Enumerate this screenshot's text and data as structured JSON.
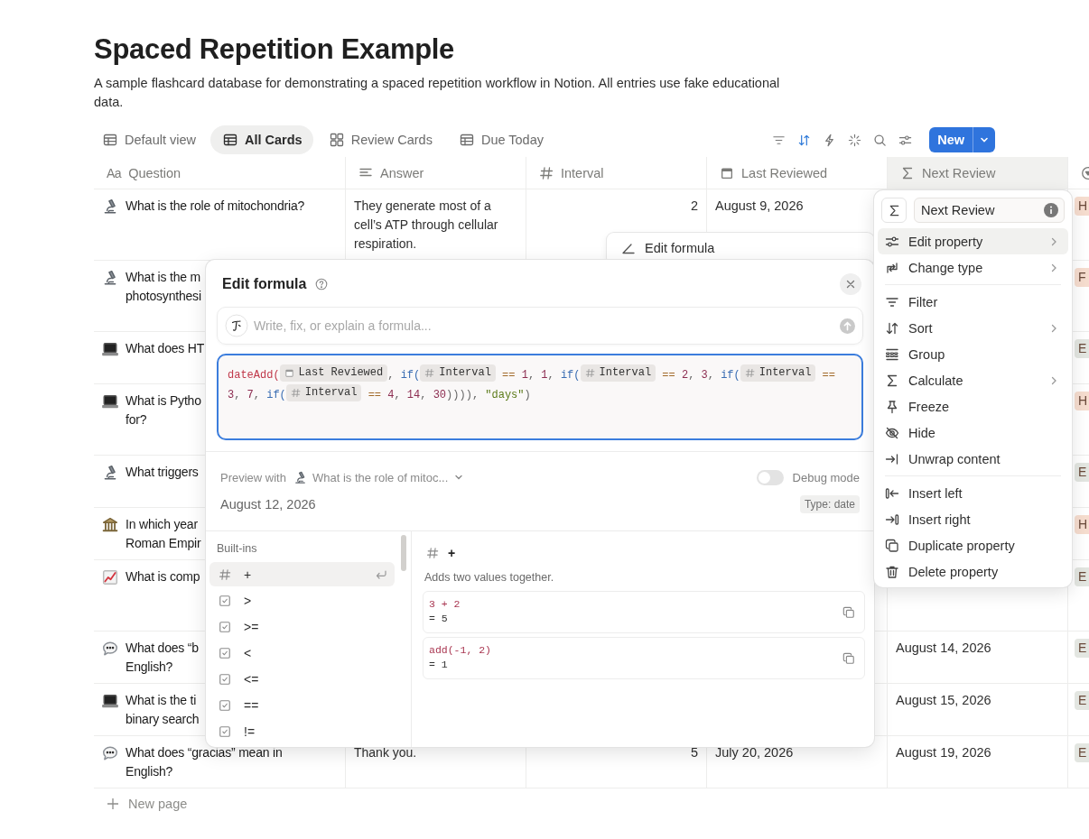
{
  "page": {
    "title": "Spaced Repetition Example",
    "description": "A sample flashcard database for demonstrating a spaced repetition workflow in Notion. All entries use fake educational data."
  },
  "tabs": [
    {
      "label": "Default view",
      "kind": "table",
      "selected": false
    },
    {
      "label": "All Cards",
      "kind": "table",
      "selected": true
    },
    {
      "label": "Review Cards",
      "kind": "gallery",
      "selected": false
    },
    {
      "label": "Due Today",
      "kind": "table",
      "selected": false
    }
  ],
  "toolbar": {
    "new_button": "New"
  },
  "columns": [
    {
      "label": "Question",
      "kind": "title",
      "glyph": "Aa",
      "selected": false
    },
    {
      "label": "Answer",
      "kind": "text",
      "selected": false
    },
    {
      "label": "Interval",
      "kind": "number",
      "selected": false
    },
    {
      "label": "Last Reviewed",
      "kind": "date",
      "selected": false
    },
    {
      "label": "Next Review",
      "kind": "formula",
      "selected": true
    },
    {
      "kind": "status",
      "selected": false
    }
  ],
  "rows": [
    {
      "kind": "microscope",
      "question": [
        "What is the role of mitochondria?"
      ],
      "answer": "They generate most of a cell’s ATP through cellular respiration.",
      "interval": "2",
      "last_reviewed": "August 9, 2026",
      "tag": {
        "text": "H",
        "color": "#f6ddcf"
      }
    },
    {
      "kind": "microscope",
      "question": [
        "What is the m",
        "photosynthesi"
      ],
      "tag": {
        "text": "F",
        "color": "#f6ddcf"
      }
    },
    {
      "kind": "laptop",
      "question": [
        "What does HT"
      ],
      "tag": {
        "text": "E",
        "color": "#e3e6e1"
      }
    },
    {
      "kind": "laptop",
      "question": [
        "What is Pytho",
        "for?"
      ],
      "tag": {
        "text": "H",
        "color": "#f6ddcf"
      }
    },
    {
      "kind": "microscope",
      "question": [
        "What triggers"
      ],
      "tag": {
        "text": "E",
        "color": "#e3e6e1"
      }
    },
    {
      "kind": "building",
      "question": [
        "In which year",
        "Roman Empir"
      ],
      "tag": {
        "text": "H",
        "color": "#f6ddcf"
      }
    },
    {
      "kind": "chart",
      "question": [
        "What is comp"
      ],
      "tag": {
        "text": "E",
        "color": "#e3e6e1"
      }
    },
    {
      "kind": "speech",
      "question": [
        "What does “b",
        "English?"
      ],
      "next_review": "August 14, 2026",
      "tag": {
        "text": "E",
        "color": "#e3e6e1"
      }
    },
    {
      "kind": "laptop",
      "question": [
        "What is the ti",
        "binary search"
      ],
      "next_review": "August 15, 2026",
      "tag": {
        "text": "E",
        "color": "#e3e6e1"
      }
    },
    {
      "kind": "speech",
      "question": [
        "What does “gracias” mean in",
        "English?"
      ],
      "answer": "Thank you.",
      "interval": "5",
      "last_reviewed": "July 20, 2026",
      "next_review": "August 19, 2026",
      "tag": {
        "text": "E",
        "color": "#e3e6e1"
      }
    }
  ],
  "new_page": "New page",
  "formula_bar": {
    "label": "Edit formula"
  },
  "formula_editor": {
    "title": "Edit formula",
    "ai_placeholder": "Write, fix, or explain a formula...",
    "tokens": [
      {
        "kind": "func",
        "text": "dateAdd("
      },
      {
        "kind": "date_prop",
        "text": "Last Reviewed"
      },
      {
        "kind": "punct",
        "text": ", "
      },
      {
        "kind": "keyword",
        "text": "if("
      },
      {
        "kind": "number_prop",
        "text": "Interval"
      },
      {
        "kind": "op",
        "text": " == "
      },
      {
        "kind": "num",
        "text": "1"
      },
      {
        "kind": "punct",
        "text": ", "
      },
      {
        "kind": "num",
        "text": "1"
      },
      {
        "kind": "punct",
        "text": ", "
      },
      {
        "kind": "keyword",
        "text": "if("
      },
      {
        "kind": "number_prop",
        "text": "Interval"
      },
      {
        "kind": "op",
        "text": " == "
      },
      {
        "kind": "num",
        "text": "2"
      },
      {
        "kind": "punct",
        "text": ", "
      },
      {
        "kind": "num",
        "text": "3"
      },
      {
        "kind": "punct",
        "text": ", "
      },
      {
        "kind": "keyword",
        "text": "if("
      },
      {
        "kind": "number_prop",
        "text": "Interval"
      },
      {
        "kind": "op",
        "text": " == "
      },
      {
        "kind": "num",
        "text": "3"
      },
      {
        "kind": "punct",
        "text": ", "
      },
      {
        "kind": "num",
        "text": "7"
      },
      {
        "kind": "punct",
        "text": ", "
      },
      {
        "kind": "keyword",
        "text": "if("
      },
      {
        "kind": "number_prop",
        "text": "Interval"
      },
      {
        "kind": "op",
        "text": " == "
      },
      {
        "kind": "num",
        "text": "4"
      },
      {
        "kind": "punct",
        "text": ", "
      },
      {
        "kind": "num",
        "text": "14"
      },
      {
        "kind": "punct",
        "text": ", "
      },
      {
        "kind": "num",
        "text": "30"
      },
      {
        "kind": "punct",
        "text": ")))), "
      },
      {
        "kind": "str",
        "text": "\"days\""
      },
      {
        "kind": "punct",
        "text": ")"
      }
    ],
    "preview": {
      "label": "Preview with",
      "page": "What is the role of mitoc...",
      "debug_label": "Debug mode",
      "debug_on": false,
      "result": "August 12, 2026",
      "type": "Type: date"
    },
    "builtins": {
      "heading": "Built-ins",
      "items": [
        {
          "kind": "number",
          "label": "+",
          "selected": true
        },
        {
          "kind": "checkbox",
          "label": ">",
          "selected": false
        },
        {
          "kind": "checkbox",
          "label": ">=",
          "selected": false
        },
        {
          "kind": "checkbox",
          "label": "<",
          "selected": false
        },
        {
          "kind": "checkbox",
          "label": "<=",
          "selected": false
        },
        {
          "kind": "checkbox",
          "label": "==",
          "selected": false
        },
        {
          "kind": "checkbox",
          "label": "!=",
          "selected": false
        }
      ]
    },
    "detail": {
      "name": "+",
      "description": "Adds two values together.",
      "examples": [
        {
          "code": "3 + 2",
          "result": "= 5"
        },
        {
          "code": "add(-1, 2)",
          "result": "= 1"
        }
      ]
    }
  },
  "column_menu": {
    "name": "Next Review",
    "sections": [
      [
        {
          "kind": "sliders",
          "label": "Edit property",
          "submenu": true,
          "selected": true
        },
        {
          "kind": "change",
          "label": "Change type",
          "submenu": true,
          "selected": false
        }
      ],
      [
        {
          "kind": "filter",
          "label": "Filter",
          "submenu": false,
          "selected": false
        },
        {
          "kind": "sort",
          "label": "Sort",
          "submenu": true,
          "selected": false
        },
        {
          "kind": "group",
          "label": "Group",
          "submenu": false,
          "selected": false
        },
        {
          "kind": "formula",
          "label": "Calculate",
          "submenu": true,
          "selected": false
        },
        {
          "kind": "pin",
          "label": "Freeze",
          "submenu": false,
          "selected": false
        },
        {
          "kind": "eyeoff",
          "label": "Hide",
          "submenu": false,
          "selected": false
        },
        {
          "kind": "unwrap",
          "label": "Unwrap content",
          "submenu": false,
          "selected": false
        }
      ],
      [
        {
          "kind": "insleft",
          "label": "Insert left",
          "submenu": false,
          "selected": false
        },
        {
          "kind": "insright",
          "label": "Insert right",
          "submenu": false,
          "selected": false
        },
        {
          "kind": "copy",
          "label": "Duplicate property",
          "submenu": false,
          "selected": false
        },
        {
          "kind": "trash",
          "label": "Delete property",
          "submenu": false,
          "selected": false
        }
      ]
    ]
  }
}
